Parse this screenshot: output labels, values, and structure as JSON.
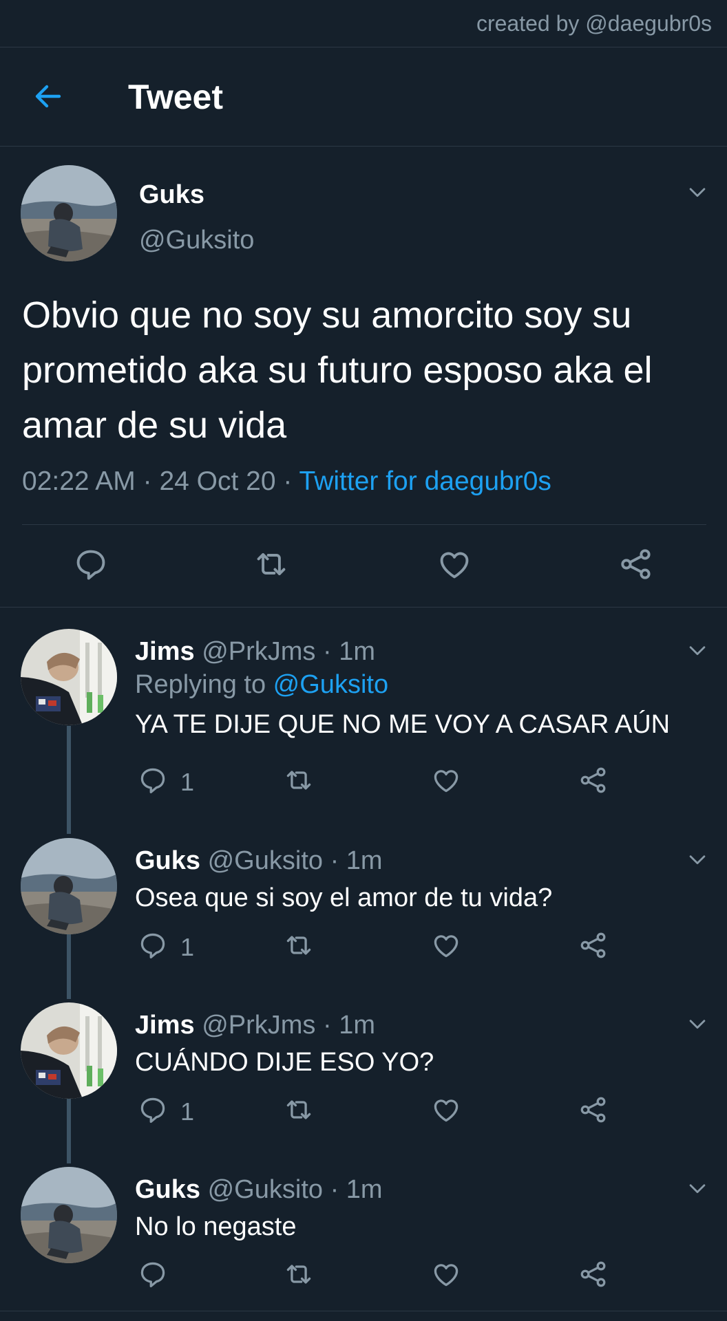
{
  "watermark": "created by @daegubr0s",
  "header": {
    "title": "Tweet",
    "back_icon": "back-arrow-icon"
  },
  "colors": {
    "background": "#15202b",
    "accent": "#1da1f2",
    "muted": "#8899a6"
  },
  "tweet": {
    "name": "Guks",
    "handle": "@Guksito",
    "text": "Obvio que no soy su amorcito soy su prometido aka su futuro esposo aka el amar de su vida",
    "time": "02:22 AM",
    "sep1": " · ",
    "date": "24 Oct 20",
    "sep2": " · ",
    "source": "Twitter for daegubr0s"
  },
  "replies": [
    {
      "name": "Jims",
      "handle": "@PrkJms",
      "sep": " · ",
      "time": "1m",
      "replying_prefix": "Replying to ",
      "replying_to": "@Guksito",
      "text": "YA TE DIJE QUE NO ME VOY A CASAR AÚN",
      "reply_count": "1"
    },
    {
      "name": "Guks",
      "handle": "@Guksito",
      "sep": " · ",
      "time": "1m",
      "text": "Osea que si soy el amor de tu vida?",
      "reply_count": "1"
    },
    {
      "name": "Jims",
      "handle": "@PrkJms",
      "sep": " · ",
      "time": "1m",
      "text": "CUÁNDO DIJE ESO YO?",
      "reply_count": "1"
    },
    {
      "name": "Guks",
      "handle": "@Guksito",
      "sep": " · ",
      "time": "1m",
      "text": "No lo negaste",
      "reply_count": ""
    }
  ]
}
